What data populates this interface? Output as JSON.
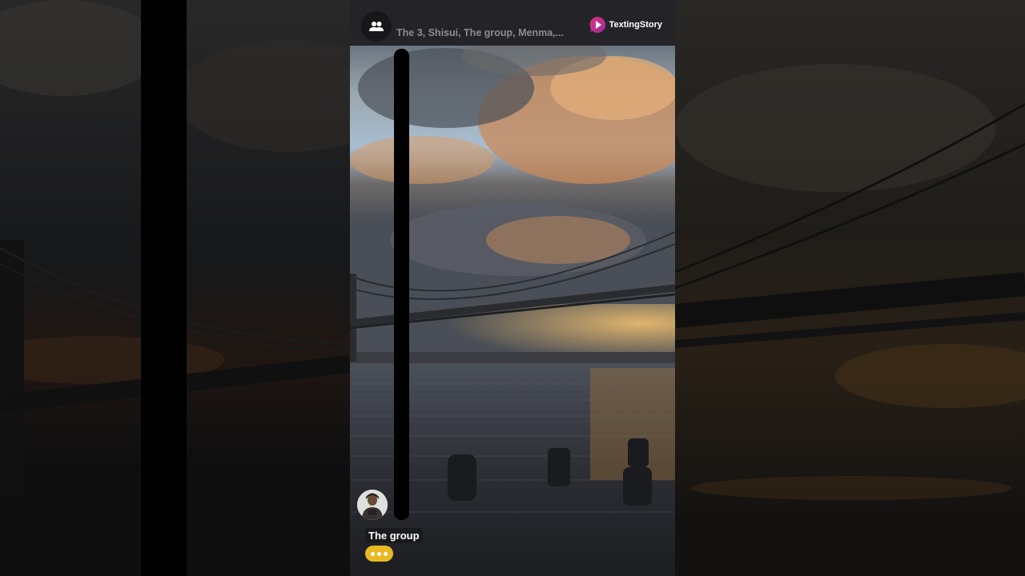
{
  "header": {
    "chat_title": "The 3, Shisui, The group, Menma,...",
    "group_icon": "group-icon",
    "brand_name": "TextingStory",
    "brand_icon": "play-bubble-icon"
  },
  "message": {
    "sender_name": "The group",
    "avatar": "avatar",
    "typing_indicator": "typing-dots",
    "typing_color": "#e8b923"
  },
  "colors": {
    "topbar": "#242428",
    "brand_accent": "#e0337a"
  }
}
